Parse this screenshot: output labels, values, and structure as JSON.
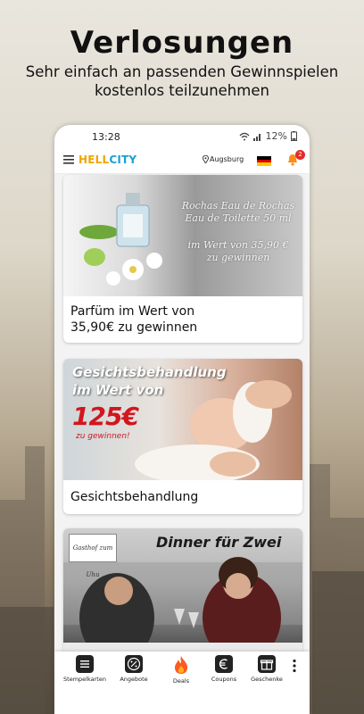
{
  "headline": "Verlosungen",
  "subline_1": "Sehr einfach an passenden Gewinnspielen",
  "subline_2": "kostenlos teilzunehmen",
  "status": {
    "time": "13:28",
    "battery": "12%"
  },
  "appbar": {
    "logo_1": "HELL",
    "logo_2": "CITY",
    "location": "Augsburg",
    "notification_count": "2"
  },
  "cards": [
    {
      "image_lines": [
        "Rochas Eau de Rochas",
        "Eau de Toilette 50 ml",
        "im Wert von 35,90 €",
        "zu gewinnen"
      ],
      "title_1": "Parfüm im Wert von",
      "title_2": "35,90€ zu gewinnen"
    },
    {
      "image_line_1": "Gesichtsbehandlung",
      "image_line_2": "im Wert von",
      "image_price": "125€",
      "image_win": "zu gewinnen!",
      "title": "Gesichtsbehandlung"
    },
    {
      "image_headline": "Dinner für Zwei",
      "stamp": "Gasthof zum Uhu"
    }
  ],
  "nav": [
    {
      "label": "Stempelkarten",
      "icon": "stempel-icon"
    },
    {
      "label": "Angebote",
      "icon": "percent-icon"
    },
    {
      "label": "Deals",
      "icon": "fire-icon"
    },
    {
      "label": "Coupons",
      "icon": "euro-icon"
    },
    {
      "label": "Geschenke",
      "icon": "gift-icon"
    }
  ],
  "colors": {
    "logo_yellow": "#f0a500",
    "logo_blue": "#1d9fd6",
    "badge_red": "#e52a2a",
    "price_red": "#d2161d",
    "deals_orange": "#ff5a1f"
  }
}
